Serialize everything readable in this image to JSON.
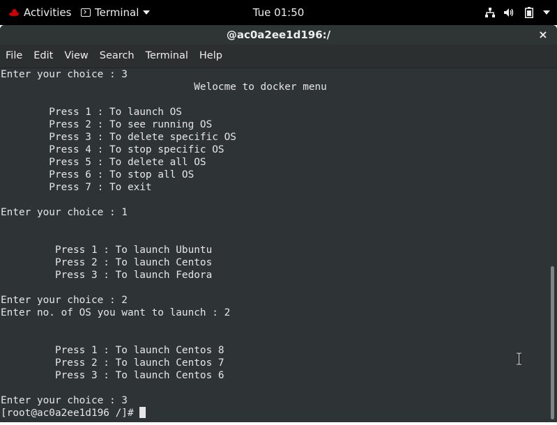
{
  "topbar": {
    "activities": "Activities",
    "app_menu": "Terminal",
    "clock": "Tue 01:50",
    "tray_icons": [
      "network-icon",
      "volume-icon",
      "battery-icon",
      "system-menu-caret-icon"
    ]
  },
  "window": {
    "title": "@ac0a2ee1d196:/",
    "close": "×"
  },
  "menubar": {
    "items": [
      "File",
      "Edit",
      "View",
      "Search",
      "Terminal",
      "Help"
    ]
  },
  "terminal": {
    "lines": [
      "Enter your choice : 3",
      "                                Welocme to docker menu",
      "",
      "        Press 1 : To launch OS",
      "        Press 2 : To see running OS",
      "        Press 3 : To delete specific OS",
      "        Press 4 : To stop specific OS",
      "        Press 5 : To delete all OS",
      "        Press 6 : To stop all OS",
      "        Press 7 : To exit",
      "",
      "Enter your choice : 1",
      "",
      "",
      "         Press 1 : To launch Ubuntu",
      "         Press 2 : To launch Centos",
      "         Press 3 : To launch Fedora",
      "",
      "Enter your choice : 2",
      "Enter no. of OS you want to launch : 2",
      "",
      "",
      "         Press 1 : To launch Centos 8",
      "         Press 2 : To launch Centos 7",
      "         Press 3 : To launch Centos 6",
      "",
      "Enter your choice : 3"
    ],
    "prompt": "[root@ac0a2ee1d196 /]# "
  },
  "colors": {
    "topbar_bg": "#000000",
    "header_bg": "#2f3435",
    "terminal_bg": "#2e3436",
    "terminal_fg": "#e6e6e6",
    "redhat_red": "#cc0000"
  }
}
